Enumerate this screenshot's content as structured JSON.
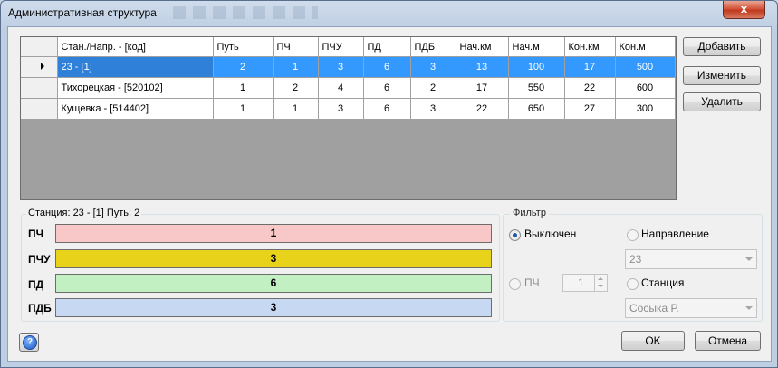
{
  "window": {
    "title": "Административная структура",
    "close": "x"
  },
  "grid": {
    "columns": [
      "Стан./Напр. - [код]",
      "Путь",
      "ПЧ",
      "ПЧУ",
      "ПД",
      "ПДБ",
      "Нач.км",
      "Нач.м",
      "Кон.км",
      "Кон.м"
    ],
    "rows": [
      [
        "23 - [1]",
        "2",
        "1",
        "3",
        "6",
        "3",
        "13",
        "100",
        "17",
        "500"
      ],
      [
        "Тихорецкая - [520102]",
        "1",
        "2",
        "4",
        "6",
        "2",
        "17",
        "550",
        "22",
        "600"
      ],
      [
        "Кущевка - [514402]",
        "1",
        "1",
        "3",
        "6",
        "3",
        "22",
        "650",
        "27",
        "300"
      ]
    ],
    "selected_row": 0
  },
  "buttons": {
    "add": "Добавить",
    "edit": "Изменить",
    "delete": "Удалить",
    "ok": "OK",
    "cancel": "Отмена"
  },
  "station": {
    "title": "Станция: 23 - [1] Путь: 2",
    "items": [
      {
        "label": "ПЧ",
        "value": "1",
        "color": "#f8c8c8"
      },
      {
        "label": "ПЧУ",
        "value": "3",
        "color": "#e8d21a"
      },
      {
        "label": "ПД",
        "value": "6",
        "color": "#c2f0c2"
      },
      {
        "label": "ПДБ",
        "value": "3",
        "color": "#c6d8f2"
      }
    ]
  },
  "filter": {
    "title": "Фильтр",
    "off_label": "Выключен",
    "direction_label": "Направление",
    "direction_value": "23",
    "pch_label": "ПЧ",
    "pch_value": "1",
    "station_label": "Станция",
    "station_value": "Сосыка Р."
  },
  "colors": {
    "selection": "#3399ff",
    "window_frame": "#bfcfe3"
  }
}
